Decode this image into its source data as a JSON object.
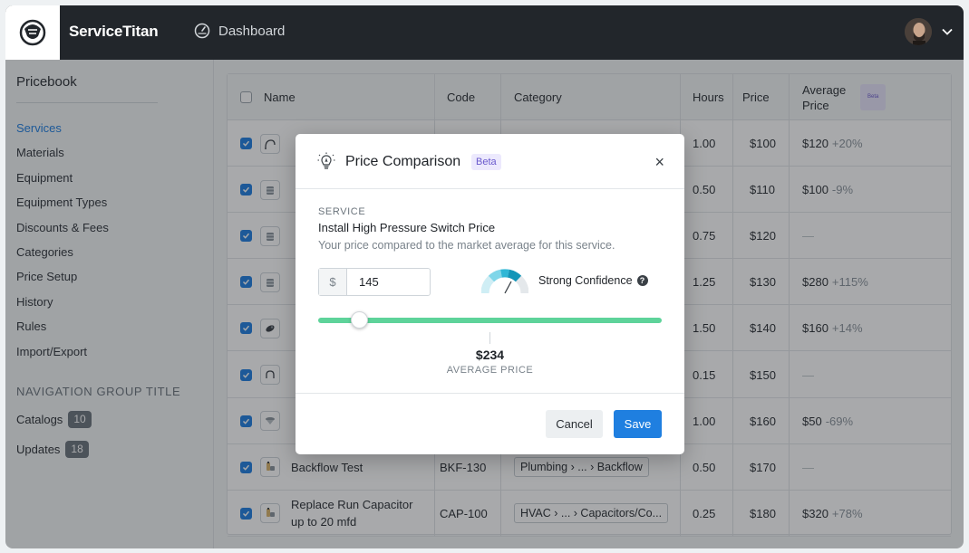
{
  "app": {
    "brand": "ServiceTitan",
    "nav_label": "Dashboard"
  },
  "sidebar": {
    "title": "Pricebook",
    "items": [
      {
        "label": "Services",
        "active": true
      },
      {
        "label": "Materials"
      },
      {
        "label": "Equipment"
      },
      {
        "label": "Equipment Types"
      },
      {
        "label": "Discounts & Fees"
      },
      {
        "label": "Categories"
      },
      {
        "label": "Price Setup"
      },
      {
        "label": "History"
      },
      {
        "label": "Rules"
      },
      {
        "label": "Import/Export"
      }
    ],
    "group_title": "NAVIGATION GROUP TITLE",
    "catalogs": {
      "label": "Catalogs",
      "count": "10"
    },
    "updates": {
      "label": "Updates",
      "count": "18"
    }
  },
  "table": {
    "headers": {
      "name": "Name",
      "code": "Code",
      "category": "Category",
      "hours": "Hours",
      "price": "Price",
      "avg_price": "Average Price",
      "avg_beta": "Beta"
    },
    "rows": [
      {
        "icon": "cable-icon",
        "name": "",
        "code": "",
        "category": "",
        "hours": "1.00",
        "price": "$100",
        "avg": "$120",
        "pct": "+20%"
      },
      {
        "icon": "drum-icon",
        "name": "",
        "code": "",
        "category": "",
        "hours": "0.50",
        "price": "$110",
        "avg": "$100",
        "pct": "-9%"
      },
      {
        "icon": "drum-icon",
        "name": "",
        "code": "",
        "category": "",
        "hours": "0.75",
        "price": "$120",
        "avg": "—",
        "pct": ""
      },
      {
        "icon": "drum-icon",
        "name": "",
        "code": "",
        "category": "",
        "hours": "1.25",
        "price": "$130",
        "avg": "$280",
        "pct": "+115%"
      },
      {
        "icon": "camera-icon",
        "name": "",
        "code": "",
        "category": "",
        "hours": "1.50",
        "price": "$140",
        "avg": "$160",
        "pct": "+14%"
      },
      {
        "icon": "hose-icon",
        "name": "",
        "code": "",
        "category": "",
        "hours": "0.15",
        "price": "$150",
        "avg": "—",
        "pct": ""
      },
      {
        "icon": "filter-icon",
        "name": "",
        "code": "",
        "category": "",
        "hours": "1.00",
        "price": "$160",
        "avg": "$50",
        "pct": "-69%"
      },
      {
        "icon": "valve-icon",
        "name": "Backflow Test",
        "code": "BKF-130",
        "category": "Plumbing › ... › Backflow",
        "hours": "0.50",
        "price": "$170",
        "avg": "—",
        "pct": ""
      },
      {
        "icon": "valve-icon",
        "name": "Replace Run Capacitor up to 20 mfd",
        "code": "CAP-100",
        "category": "HVAC › ... › Capacitors/Co...",
        "hours": "0.25",
        "price": "$180",
        "avg": "$320",
        "pct": "+78%"
      }
    ]
  },
  "modal": {
    "title": "Price Comparison",
    "beta": "Beta",
    "close": "×",
    "kicker": "SERVICE",
    "service_name": "Install High Pressure Switch Price",
    "description": "Your price compared to the market average for this service.",
    "currency": "$",
    "price_value": "145",
    "confidence": "Strong Confidence",
    "average_value": "$234",
    "average_label": "AVERAGE PRICE",
    "cancel": "Cancel",
    "save": "Save",
    "slider_fraction": 0.12
  },
  "colors": {
    "primary": "#1f7fe0",
    "topbar": "#22262b",
    "slider": "#5ed39a",
    "beta_bg": "#ece9fd",
    "beta_text": "#6a5acd"
  }
}
